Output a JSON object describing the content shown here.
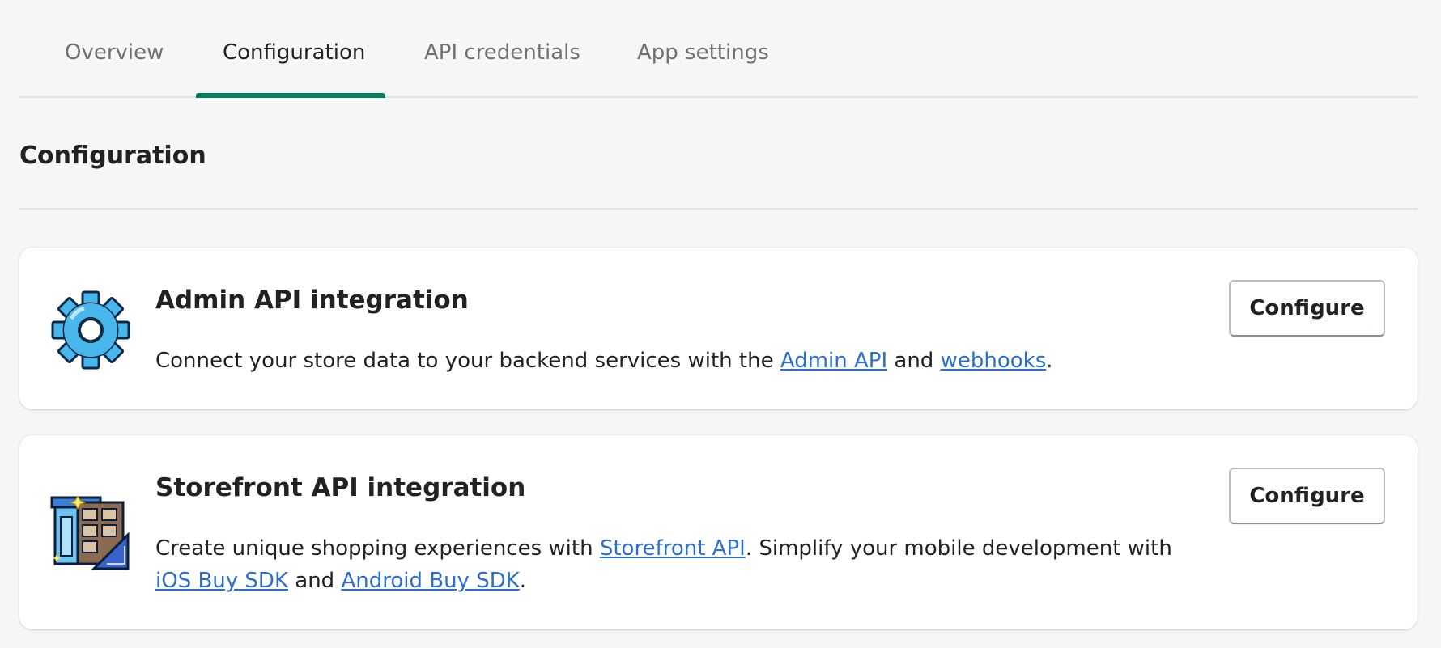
{
  "tabs": [
    {
      "label": "Overview",
      "active": false
    },
    {
      "label": "Configuration",
      "active": true
    },
    {
      "label": "API credentials",
      "active": false
    },
    {
      "label": "App settings",
      "active": false
    }
  ],
  "section": {
    "title": "Configuration"
  },
  "cards": [
    {
      "icon": "gear-icon",
      "title": "Admin API integration",
      "description": {
        "part1": "Connect your store data to your backend services with the ",
        "link1": "Admin API",
        "part2": " and ",
        "link2": "webhooks",
        "part3": "."
      },
      "button_label": "Configure"
    },
    {
      "icon": "storefront-icon",
      "title": "Storefront API integration",
      "description": {
        "part1": "Create unique shopping experiences with ",
        "link1": "Storefront API",
        "part2": ". Simplify your mobile development with ",
        "link2": "iOS Buy SDK",
        "part3": " and ",
        "link3": "Android Buy SDK",
        "part4": "."
      },
      "button_label": "Configure"
    }
  ],
  "colors": {
    "accent": "#008060",
    "link": "#2c6ecb",
    "background": "#f6f6f6",
    "card": "#ffffff"
  }
}
